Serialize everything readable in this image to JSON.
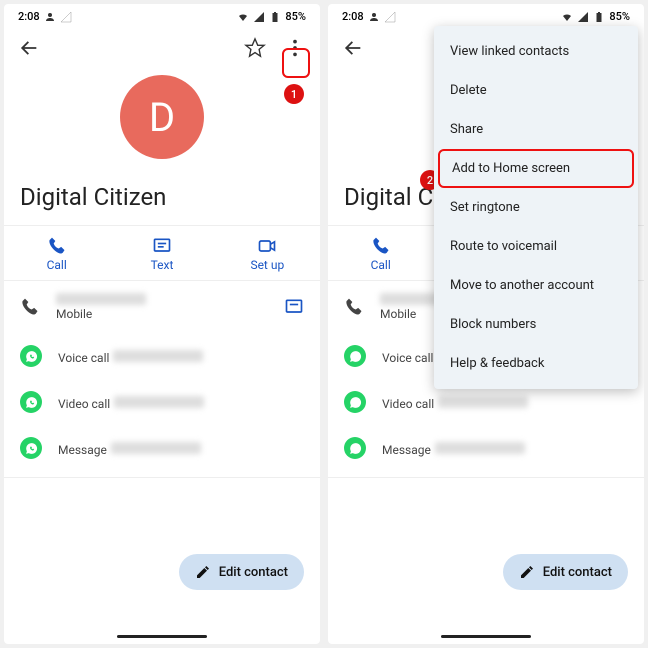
{
  "status": {
    "time": "2:08",
    "battery": "85%"
  },
  "contact": {
    "initial": "D",
    "name": "Digital Citizen"
  },
  "actions": {
    "call": "Call",
    "text": "Text",
    "setup": "Set up"
  },
  "rows": {
    "mobile": "Mobile",
    "voice": "Voice call",
    "video": "Video call",
    "msg": "Message"
  },
  "fab": "Edit contact",
  "menu": {
    "linked": "View linked contacts",
    "delete": "Delete",
    "share": "Share",
    "home": "Add to Home screen",
    "ringtone": "Set ringtone",
    "voicemail": "Route to voicemail",
    "move": "Move to another account",
    "block": "Block numbers",
    "help": "Help & feedback"
  },
  "badges": {
    "b1": "1",
    "b2": "2"
  }
}
